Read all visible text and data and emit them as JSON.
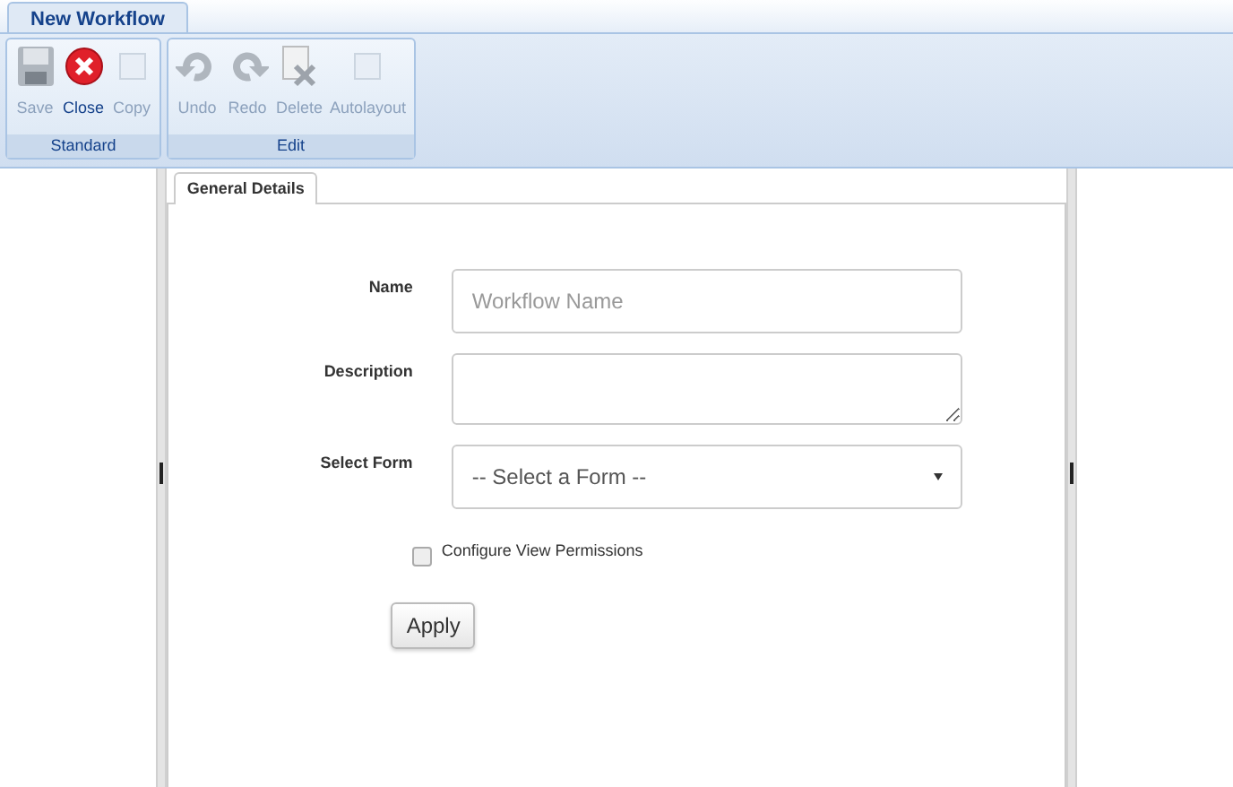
{
  "document_tabs": [
    {
      "label": "New Workflow",
      "selected": true
    }
  ],
  "ribbon_groups": [
    {
      "label": "Standard",
      "buttons": [
        {
          "label": "Save",
          "kind": "save",
          "disabled": true
        },
        {
          "label": "Close",
          "kind": "close",
          "disabled": false
        },
        {
          "label": "Copy",
          "kind": "blank",
          "disabled": true
        }
      ]
    },
    {
      "label": "Edit",
      "buttons": [
        {
          "label": "Undo",
          "kind": "undo",
          "disabled": true
        },
        {
          "label": "Redo",
          "kind": "redo",
          "disabled": true
        },
        {
          "label": "Delete",
          "kind": "delete",
          "disabled": true
        },
        {
          "label": "Autolayout",
          "kind": "blank",
          "disabled": true
        }
      ]
    }
  ],
  "panel_tabs": [
    {
      "label": "General Details",
      "selected": true
    }
  ],
  "fields": [
    {
      "label": "Name",
      "kind": "text",
      "placeholder": "Workflow Name"
    },
    {
      "label": "Description",
      "kind": "textarea"
    },
    {
      "label": "Select Form",
      "kind": "select",
      "value": "-- Select a Form --"
    }
  ],
  "checkbox": {
    "label": "Configure View Permissions",
    "checked": false
  },
  "apply_button": "Apply"
}
